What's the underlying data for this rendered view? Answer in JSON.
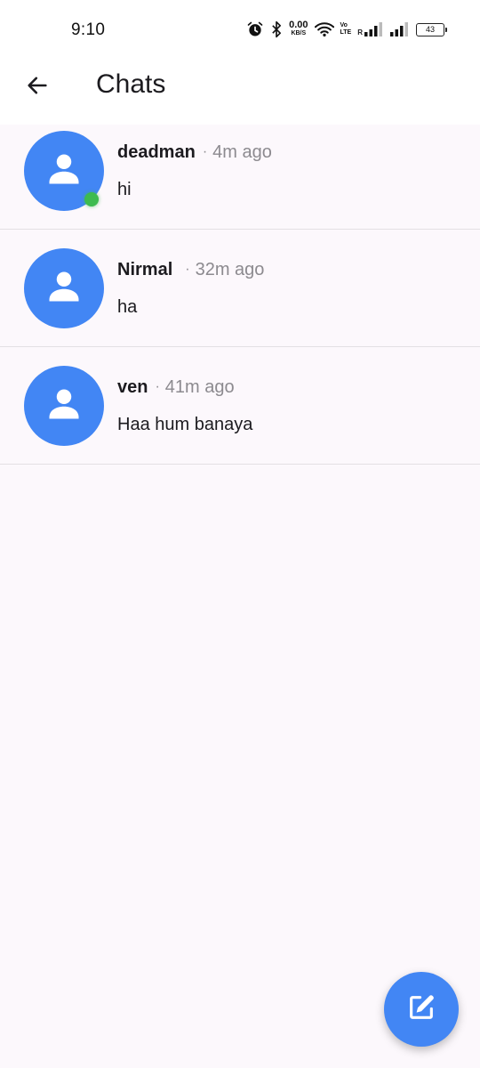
{
  "status_bar": {
    "time": "9:10",
    "net_speed_value": "0.00",
    "net_speed_unit": "KB/S",
    "volte_top": "Vo",
    "volte_mid": "LTE",
    "signal_roaming": "R",
    "battery_level": "43",
    "icons": [
      "alarm-icon",
      "bluetooth-icon",
      "wifi-icon",
      "signal-icon",
      "signal-icon",
      "battery-icon"
    ]
  },
  "app_bar": {
    "title": "Chats",
    "back_icon": "arrow-back-icon"
  },
  "chats": [
    {
      "name": "deadman",
      "separator": "·",
      "time": "4m ago",
      "message": "hi",
      "online": true
    },
    {
      "name": "Nirmal",
      "separator": "·",
      "time": "32m ago",
      "message": "ha",
      "online": false
    },
    {
      "name": "ven",
      "separator": "·",
      "time": "41m ago",
      "message": "Haa hum banaya",
      "online": false
    }
  ],
  "fab": {
    "icon": "edit-icon"
  },
  "colors": {
    "accent": "#4286f4",
    "online": "#3dbb4f",
    "background": "#fcf8fc",
    "muted_text": "#8c8a8f"
  }
}
